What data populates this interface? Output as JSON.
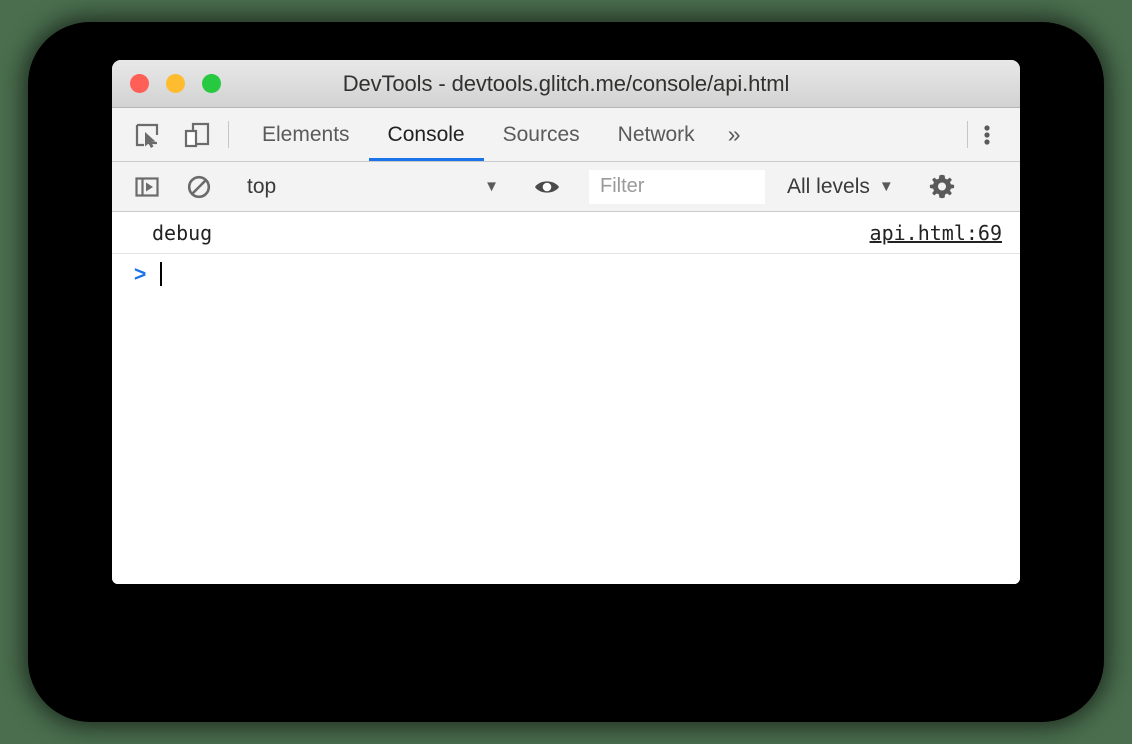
{
  "window": {
    "title": "DevTools - devtools.glitch.me/console/api.html",
    "traffic_lights": {
      "close": "close-button",
      "minimize": "minimize-button",
      "maximize": "maximize-button"
    }
  },
  "colors": {
    "accent_blue": "#1a73e8",
    "backdrop": "#000000",
    "page_background": "#4a6e4e",
    "toolbar_background": "#f3f3f3",
    "light_red": "#ff5f56",
    "light_yellow": "#febc2e",
    "light_green": "#26c940"
  },
  "tabbar": {
    "left_icons": [
      {
        "name": "inspect-element-icon",
        "label": "Inspect element"
      },
      {
        "name": "device-toolbar-icon",
        "label": "Toggle device toolbar"
      }
    ],
    "tabs": [
      {
        "label": "Elements",
        "active": false
      },
      {
        "label": "Console",
        "active": true
      },
      {
        "label": "Sources",
        "active": false
      },
      {
        "label": "Network",
        "active": false
      }
    ],
    "more_tabs_label": "»",
    "menu_icon": "more-vertical-icon"
  },
  "console_toolbar": {
    "sidebar_toggle_icon": "console-sidebar-icon",
    "clear_console_icon": "clear-console-icon",
    "context": {
      "value": "top",
      "caret": "▼"
    },
    "live_expression_icon": "eye-icon",
    "filter": {
      "value": "",
      "placeholder": "Filter"
    },
    "levels": {
      "value": "All levels",
      "caret": "▼"
    },
    "settings_icon": "gear-icon"
  },
  "console": {
    "messages": [
      {
        "text": "debug",
        "source": "api.html:69"
      }
    ],
    "prompt": {
      "arrow": ">",
      "value": ""
    }
  }
}
